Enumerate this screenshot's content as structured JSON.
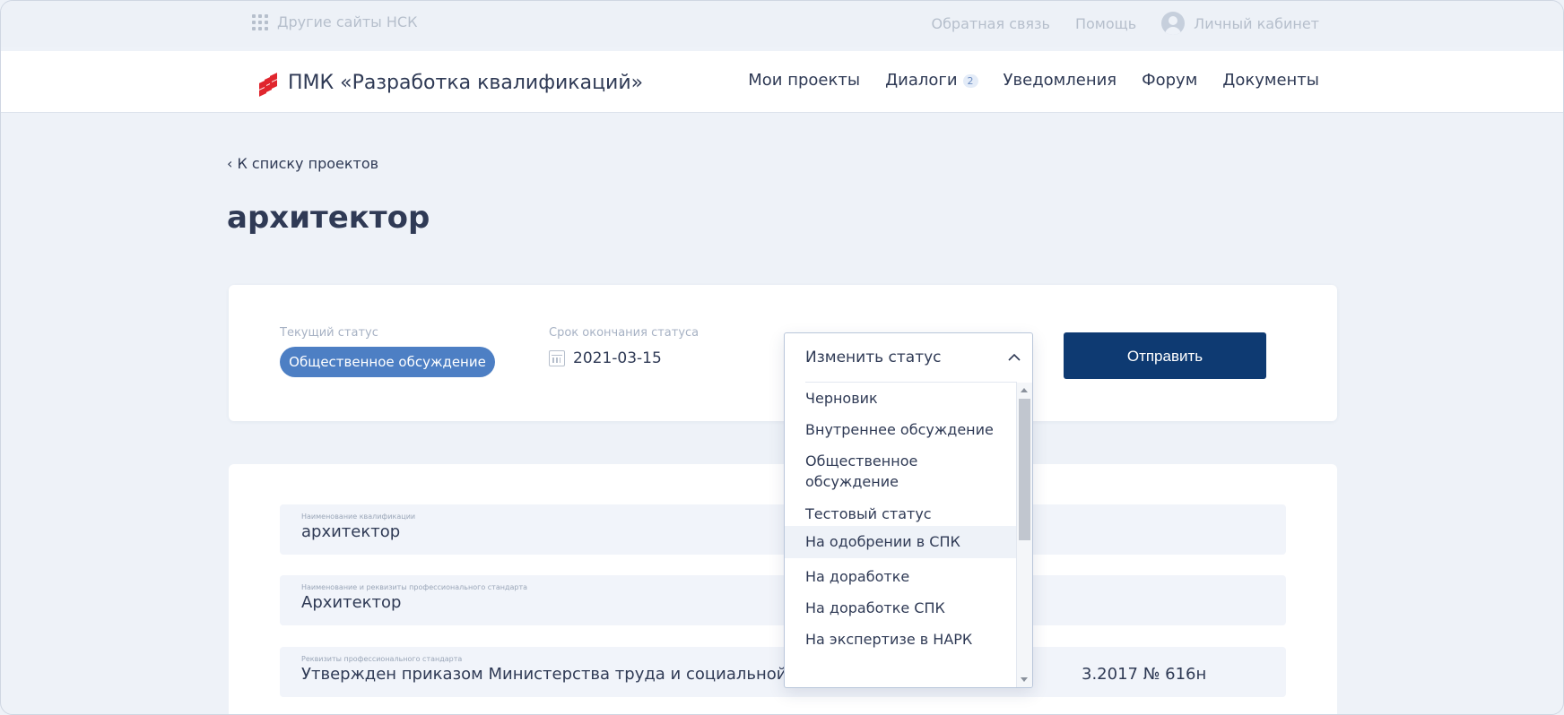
{
  "topbar": {
    "other_sites": "Другие сайты НСК",
    "feedback": "Обратная связь",
    "help": "Помощь",
    "cabinet": "Личный кабинет"
  },
  "header": {
    "logo_title": "ПМК «Разработка квалификаций»",
    "nav": {
      "projects": "Мои проекты",
      "dialogs": "Диалоги",
      "dialogs_count": "2",
      "notifications": "Уведомления",
      "forum": "Форум",
      "documents": "Документы"
    }
  },
  "page": {
    "back_link": "‹ К списку проектов",
    "title": "архитектор"
  },
  "status_card": {
    "current_status_label": "Текущий статус",
    "current_status": "Общественное обсуждение",
    "deadline_label": "Срок окончания статуса",
    "deadline": "2021-03-15",
    "send_button": "Отправить"
  },
  "status_dropdown": {
    "placeholder": "Изменить статус",
    "options": [
      "Черновик",
      "Внутреннее обсуждение",
      "Общественное",
      "обсуждение",
      "Тестовый статус",
      "На одобрении в СПК",
      "На доработке",
      "На доработке СПК",
      "На экспертизе в НАРК"
    ],
    "highlighted": "На одобрении в СПК"
  },
  "details": {
    "qualification_name_label": "Наименование квалификации",
    "qualification_name": "архитектор",
    "standard_name_label": "Наименование и реквизиты профессионального стандарта",
    "standard_name": "Архитектор",
    "standard_details_label": "Реквизиты профессионального стандарта",
    "standard_details_left": "Утвержден приказом Министерства труда и социальной защиты",
    "standard_details_right": "3.2017 № 616н"
  },
  "colors": {
    "accent": "#0e3a72",
    "status_pill": "#4d7fc4",
    "logo_red": "#e0262e",
    "background": "#eef2f8"
  }
}
